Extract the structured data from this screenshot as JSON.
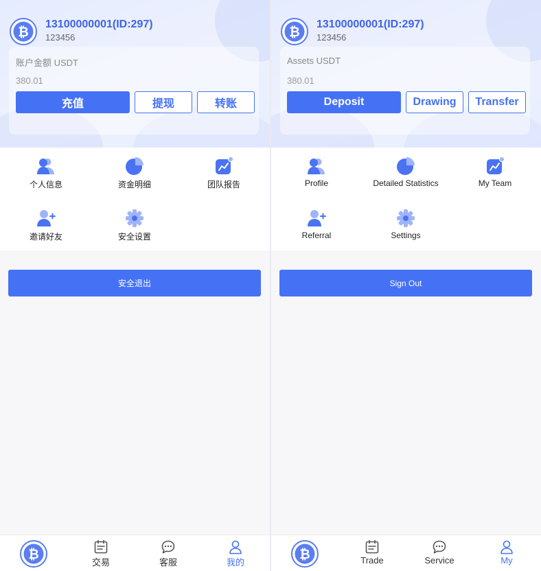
{
  "colors": {
    "accent": "#4572f5",
    "account_text": "#3d63e6"
  },
  "panels": [
    {
      "user": {
        "account": "13100000001(ID:297)",
        "password": "123456"
      },
      "balance": {
        "label": "账户金额 USDT",
        "value": "380.01"
      },
      "actions": {
        "deposit": "充值",
        "withdraw": "提现",
        "transfer": "转账"
      },
      "menu": {
        "profile": "个人信息",
        "statistics": "资金明细",
        "team": "团队报告",
        "referral": "邀请好友",
        "settings": "安全设置"
      },
      "signout": "安全退出",
      "tabs": {
        "trade": "交易",
        "service": "客服",
        "my": "我的"
      }
    },
    {
      "user": {
        "account": "13100000001(ID:297)",
        "password": "123456"
      },
      "balance": {
        "label": "Assets USDT",
        "value": "380.01"
      },
      "actions": {
        "deposit": "Deposit",
        "withdraw": "Drawing",
        "transfer": "Transfer"
      },
      "menu": {
        "profile": "Profile",
        "statistics": "Detailed Statistics",
        "team": "My Team",
        "referral": "Referral",
        "settings": "Settings"
      },
      "signout": "Sign Out",
      "tabs": {
        "trade": "Trade",
        "service": "Service",
        "my": "My"
      }
    }
  ],
  "icons": {
    "avatar": "bitcoin-logo-icon",
    "profile": "users-icon",
    "statistics": "pie-chart-icon",
    "team": "trend-chart-icon",
    "referral": "add-user-icon",
    "settings": "gear-icon",
    "trade": "calendar-icon",
    "service": "chat-icon",
    "my": "person-icon"
  }
}
